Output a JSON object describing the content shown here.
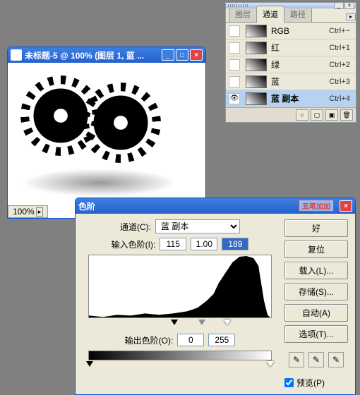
{
  "panel": {
    "tabs": [
      "图层",
      "通道",
      "路径"
    ],
    "activeTab": 1,
    "channels": [
      {
        "name": "RGB",
        "shortcut": "Ctrl+~",
        "eye": false,
        "sel": false
      },
      {
        "name": "红",
        "shortcut": "Ctrl+1",
        "eye": false,
        "sel": false
      },
      {
        "name": "绿",
        "shortcut": "Ctrl+2",
        "eye": false,
        "sel": false
      },
      {
        "name": "蓝",
        "shortcut": "Ctrl+3",
        "eye": false,
        "sel": false
      },
      {
        "name": "蓝 副本",
        "shortcut": "Ctrl+4",
        "eye": true,
        "sel": true
      }
    ],
    "footerIcons": [
      "○",
      "▢",
      "▣",
      "🗑"
    ]
  },
  "doc": {
    "title": "未标题-5 @ 100% (图层 1, 蓝 ...",
    "zoom": "100%",
    "zoomArrow": "▸"
  },
  "levels": {
    "title": "色阶",
    "stamp": "五笔加加",
    "channelLabel": "通道(C):",
    "channelValue": "蓝 副本",
    "inputLabel": "输入色阶(I):",
    "in_black": "115",
    "in_gamma": "1.00",
    "in_white": "189",
    "outputLabel": "输出色阶(O):",
    "out_black": "0",
    "out_white": "255",
    "buttons": {
      "ok": "好",
      "reset": "复位",
      "load": "载入(L)...",
      "save": "存储(S)...",
      "auto": "自动(A)",
      "options": "选项(T)..."
    },
    "previewLabel": "预览(P)",
    "triPos": {
      "b": 45,
      "g": 60,
      "w": 74
    }
  }
}
